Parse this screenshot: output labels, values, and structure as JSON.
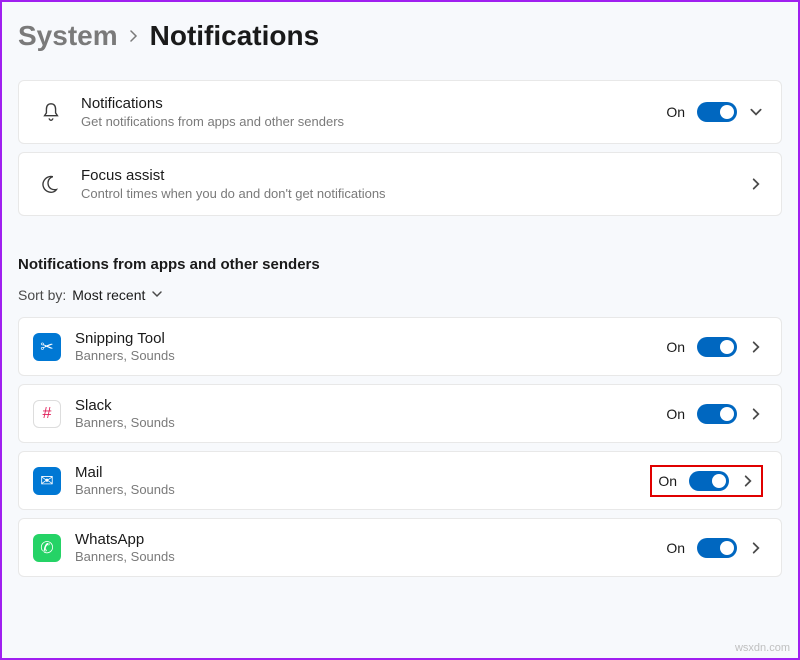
{
  "breadcrumb": {
    "parent": "System",
    "current": "Notifications"
  },
  "notifications_card": {
    "title": "Notifications",
    "desc": "Get notifications from apps and other senders",
    "state": "On"
  },
  "focus_card": {
    "title": "Focus assist",
    "desc": "Control times when you do and don't get notifications"
  },
  "section_title": "Notifications from apps and other senders",
  "sort": {
    "label": "Sort by:",
    "value": "Most recent"
  },
  "apps": [
    {
      "name": "Snipping Tool",
      "desc": "Banners, Sounds",
      "state": "On",
      "icon_bg": "#0078d4",
      "icon_glyph": "✂"
    },
    {
      "name": "Slack",
      "desc": "Banners, Sounds",
      "state": "On",
      "icon_bg": "#ffffff",
      "icon_glyph": "#",
      "icon_fg": "#e01e5a",
      "icon_border": "1px solid #ddd"
    },
    {
      "name": "Mail",
      "desc": "Banners, Sounds",
      "state": "On",
      "icon_bg": "#0078d4",
      "icon_glyph": "✉",
      "highlight": true
    },
    {
      "name": "WhatsApp",
      "desc": "Banners, Sounds",
      "state": "On",
      "icon_bg": "#25d366",
      "icon_glyph": "✆"
    }
  ],
  "watermark": "wsxdn.com"
}
